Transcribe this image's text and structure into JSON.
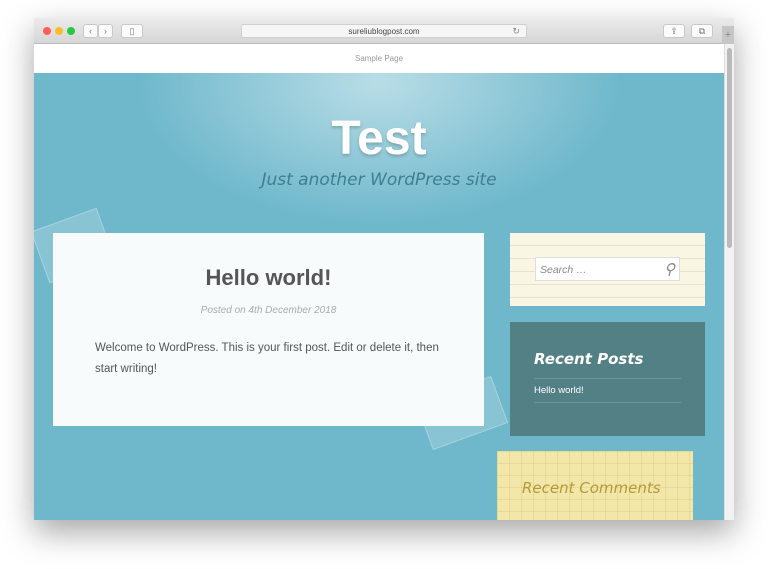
{
  "browser": {
    "url": "sureliublogpost.com",
    "back": "‹",
    "forward": "›",
    "new_tab": "+"
  },
  "nav": {
    "items": [
      "Sample Page"
    ]
  },
  "site": {
    "title": "Test",
    "tagline": "Just another WordPress site"
  },
  "post": {
    "title": "Hello world!",
    "meta": "Posted on 4th December 2018",
    "excerpt": "Welcome to WordPress. This is your first post. Edit or delete it, then start writing!"
  },
  "sidebar": {
    "search_placeholder": "Search …",
    "recent_posts_title": "Recent Posts",
    "recent_posts": [
      "Hello world!"
    ],
    "recent_comments_title": "Recent Comments"
  }
}
